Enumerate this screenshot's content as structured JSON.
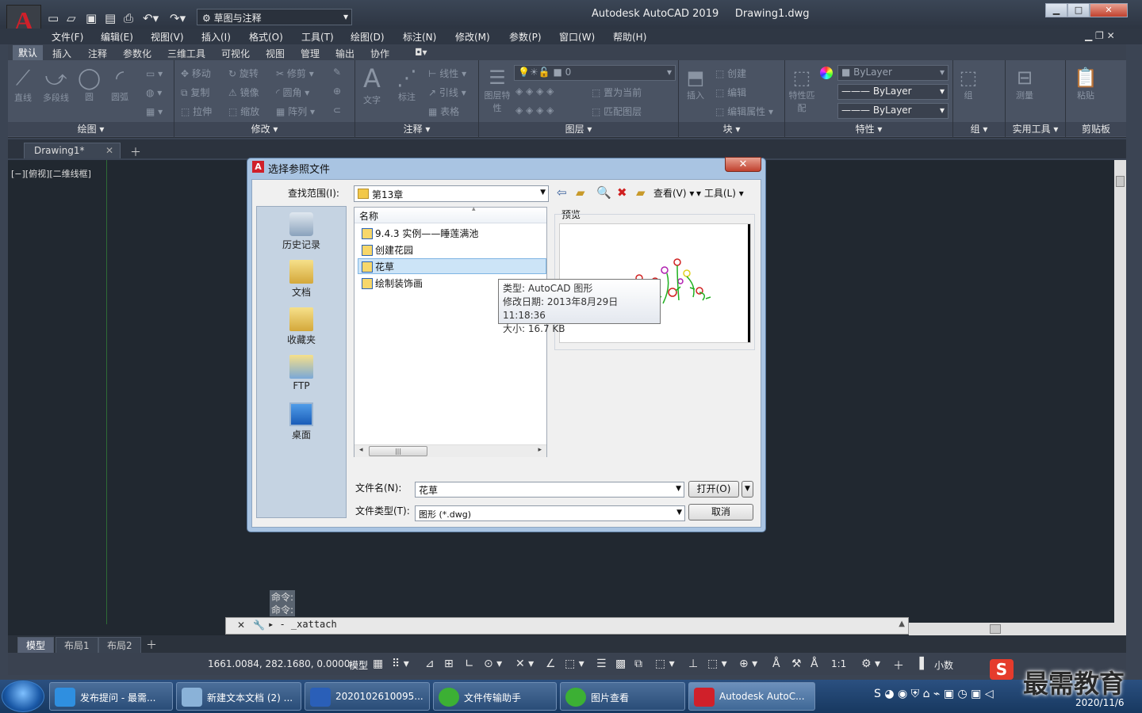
{
  "window": {
    "workspace": "草图与注释",
    "title": "Autodesk AutoCAD 2019",
    "document": "Drawing1.dwg"
  },
  "menu": [
    "文件(F)",
    "编辑(E)",
    "视图(V)",
    "插入(I)",
    "格式(O)",
    "工具(T)",
    "绘图(D)",
    "标注(N)",
    "修改(M)",
    "参数(P)",
    "窗口(W)",
    "帮助(H)"
  ],
  "ribbon_tabs": [
    "默认",
    "插入",
    "注释",
    "参数化",
    "三维工具",
    "可视化",
    "视图",
    "管理",
    "输出",
    "协作"
  ],
  "ribbon": {
    "draw": {
      "label": "绘图 ▾",
      "line": "直线",
      "polyline": "多段线",
      "circle": "圆",
      "arc": "圆弧"
    },
    "modify": {
      "label": "修改 ▾",
      "move": "移动",
      "rotate": "旋转",
      "trim": "修剪",
      "copy": "复制",
      "mirror": "镜像",
      "fillet": "圆角",
      "stretch": "拉伸",
      "scale": "缩放",
      "array": "阵列"
    },
    "annotation": {
      "label": "注释 ▾",
      "text": "文字",
      "dimension": "标注",
      "linear": "线性",
      "leader": "引线",
      "table": "表格"
    },
    "layers": {
      "label": "图层 ▾",
      "layer_props": "图层特性",
      "current_layer": "0",
      "make_current": "置为当前",
      "match_layer": "匹配图层"
    },
    "block": {
      "label": "块 ▾",
      "insert": "插入",
      "create": "创建",
      "edit": "编辑",
      "edit_attr": "编辑属性"
    },
    "properties": {
      "label": "特性 ▾",
      "match": "特性匹配",
      "color": "ByLayer",
      "linetype": "ByLayer",
      "lineweight": "ByLayer"
    },
    "groups": {
      "label": "组 ▾",
      "group": "组"
    },
    "utilities": {
      "label": "实用工具 ▾",
      "measure": "测量"
    },
    "clipboard": {
      "label": "剪贴板",
      "paste": "粘贴"
    }
  },
  "doc_tab": "Drawing1*",
  "viewport_control": "[−][俯视][二维线框]",
  "command_history": [
    "命令:",
    "命令:"
  ],
  "command_input": "_xattach",
  "layout_tabs": [
    "模型",
    "布局1",
    "布局2"
  ],
  "status": {
    "coords": "1661.0084, 282.1680, 0.0000",
    "model": "模型",
    "scale": "1:1",
    "units": "小数"
  },
  "dialog": {
    "title": "选择参照文件",
    "look_in_label": "查找范围(I):",
    "look_in": "第13章",
    "view_label": "查看(V)",
    "tools_label": "工具(L)",
    "places": [
      "历史记录",
      "文档",
      "收藏夹",
      "FTP",
      "桌面"
    ],
    "column_name": "名称",
    "files": [
      "9.4.3  实例——睡莲满池",
      "创建花园",
      "花草",
      "绘制装饰画"
    ],
    "selected_index": 2,
    "preview_label": "预览",
    "tooltip": [
      "类型: AutoCAD 图形",
      "修改日期: 2013年8月29日 11:18:36",
      "大小: 16.7 KB"
    ],
    "filename_label": "文件名(N):",
    "filename": "花草",
    "filetype_label": "文件类型(T):",
    "filetype": "图形 (*.dwg)",
    "open_button": "打开(O)",
    "cancel_button": "取消"
  },
  "taskbar": {
    "items": [
      "发布提问 - 最需...",
      "新建文本文档 (2) ...",
      "2020102610095...",
      "文件传输助手",
      "图片查看",
      "Autodesk AutoC..."
    ],
    "date": "2020/11/6"
  },
  "watermark": "最需教育"
}
